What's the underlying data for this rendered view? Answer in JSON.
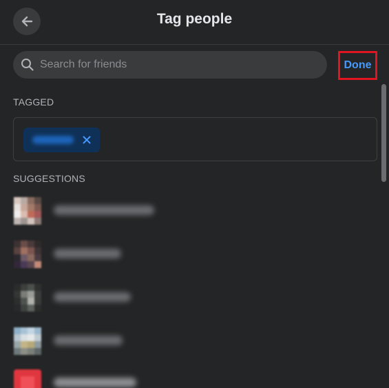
{
  "dialog": {
    "title": "Tag people"
  },
  "search": {
    "placeholder": "Search for friends",
    "value": ""
  },
  "done_label": "Done",
  "sections": {
    "tagged_label": "TAGGED",
    "suggestions_label": "SUGGESTIONS"
  },
  "tagged": [
    {
      "name_blurred": true,
      "remove_icon": "close-icon"
    }
  ],
  "suggestions": [
    {
      "name_blurred": true,
      "avatar_blurred": true
    },
    {
      "name_blurred": true,
      "avatar_blurred": true
    },
    {
      "name_blurred": true,
      "avatar_blurred": true
    },
    {
      "name_blurred": true,
      "avatar_blurred": true
    },
    {
      "name_blurred": true,
      "avatar_blurred": true
    }
  ],
  "colors": {
    "background": "#242526",
    "accent": "#4599ff",
    "highlight_box": "#e0151f",
    "chip": "#0f3157"
  }
}
